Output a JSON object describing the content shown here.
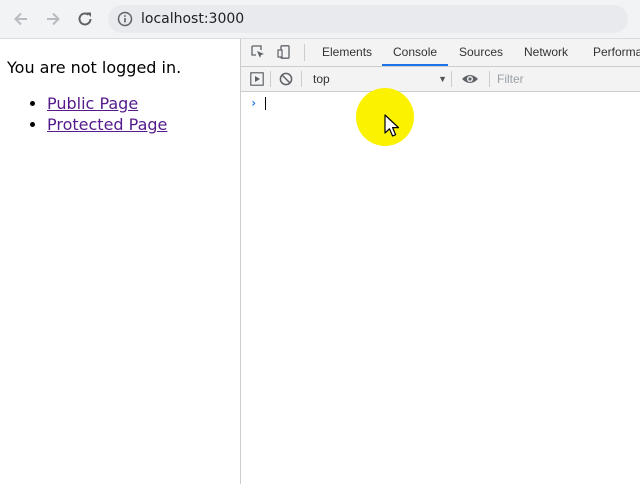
{
  "browser": {
    "url": "localhost:3000",
    "icons": [
      "back-arrow-icon",
      "forward-arrow-icon",
      "reload-icon",
      "info-icon"
    ]
  },
  "page": {
    "status_text": "You are not logged in.",
    "links": [
      {
        "label": "Public Page"
      },
      {
        "label": "Protected Page"
      }
    ],
    "link_color": "#551a8b"
  },
  "devtools": {
    "tabs": [
      {
        "label": "Elements"
      },
      {
        "label": "Console",
        "active": true
      },
      {
        "label": "Sources"
      },
      {
        "label": "Network"
      },
      {
        "label": "Performa"
      }
    ],
    "console_toolbar": {
      "context": "top",
      "filter_placeholder": "Filter"
    },
    "prompt_symbol": "›",
    "accent_color": "#1a73e8"
  },
  "cursor_highlight_color": "#fbf200"
}
